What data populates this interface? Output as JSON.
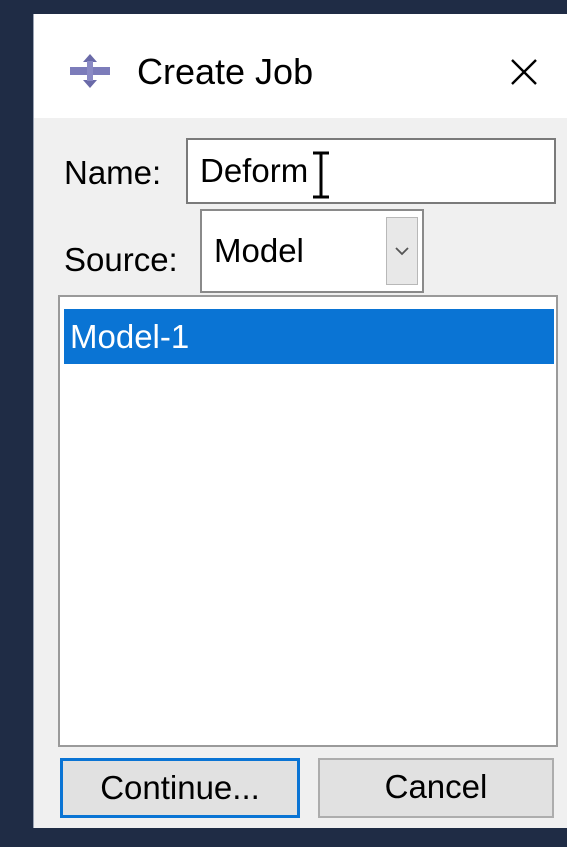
{
  "dialog": {
    "title": "Create Job",
    "app_icon": "abaqus-job-icon",
    "close_icon": "close-icon"
  },
  "form": {
    "name_label": "Name:",
    "name_value": "Deform",
    "source_label": "Source:",
    "source_value": "Model",
    "dropdown_icon": "chevron-down-icon"
  },
  "model_list": {
    "items": [
      {
        "label": "Model-1",
        "selected": true
      }
    ]
  },
  "buttons": {
    "continue_label": "Continue...",
    "cancel_label": "Cancel"
  },
  "colors": {
    "selection": "#0a74d4",
    "dialog_bg": "#f0f0f0",
    "desktop_bg": "#1f2c45"
  }
}
